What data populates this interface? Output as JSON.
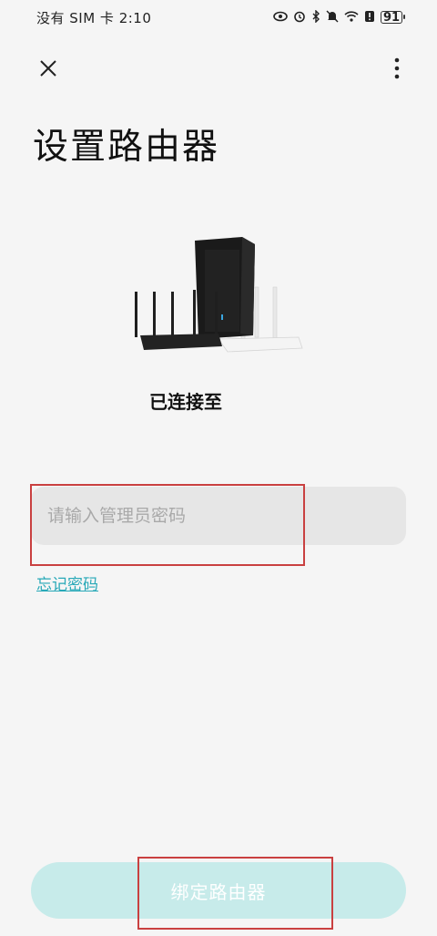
{
  "status_bar": {
    "left_text": "没有 SIM 卡 2:10",
    "icons": [
      "eye-icon",
      "alarm-icon",
      "bluetooth-icon",
      "mute-icon",
      "wifi-icon",
      "alert-icon",
      "battery-icon"
    ],
    "battery_level": "91"
  },
  "header": {
    "close_icon": "close-icon",
    "more_icon": "more-vertical-icon"
  },
  "main": {
    "title": "设置路由器",
    "image": "router-illustration",
    "connected_label": "已连接至",
    "password": {
      "value": "",
      "placeholder": "请输入管理员密码"
    },
    "forgot_link": "忘记密码",
    "bind_button": "绑定路由器"
  },
  "colors": {
    "accent": "#28a9b8",
    "button_bg": "#c7ebea",
    "input_bg": "#e6e6e6",
    "highlight": "#c94040",
    "background": "#f5f5f5"
  }
}
